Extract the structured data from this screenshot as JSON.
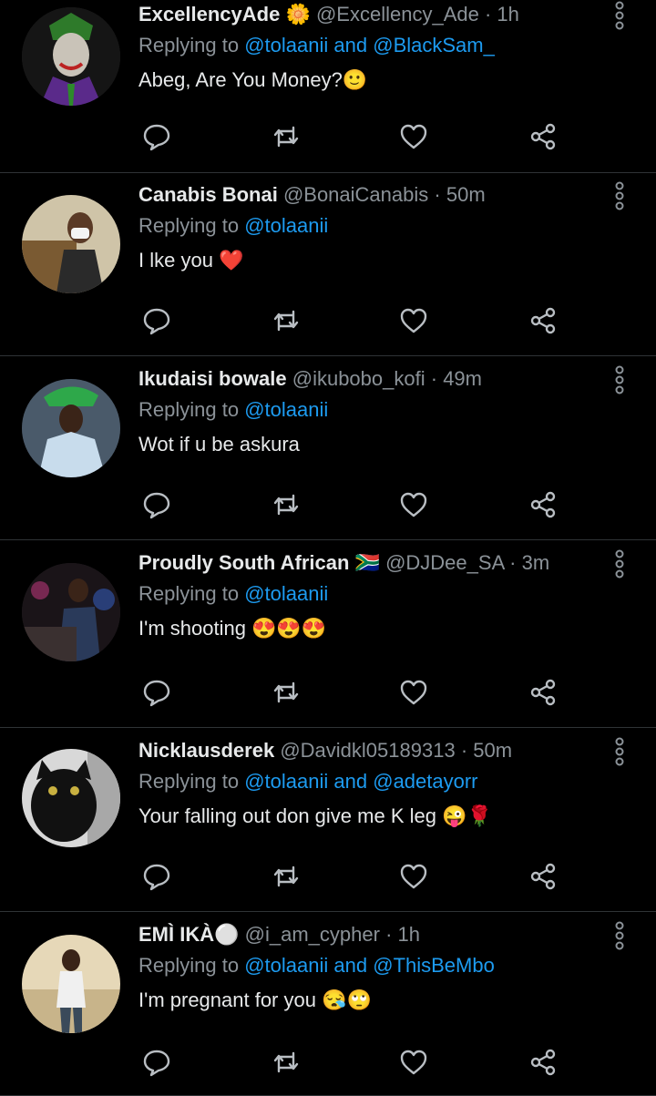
{
  "tweets": [
    {
      "name": "ExcellencyAde",
      "badge": "🌼",
      "handle": "@Excellency_Ade",
      "time": "1h",
      "replying_prefix": "Replying to",
      "mention1": "@tolaanii",
      "joiner": "and",
      "mention2": "@BlackSam_",
      "text": "Abeg, Are You Money?🙂"
    },
    {
      "name": "Canabis Bonai",
      "badge": "",
      "handle": "@BonaiCanabis",
      "time": "50m",
      "replying_prefix": "Replying to",
      "mention1": "@tolaanii",
      "joiner": "",
      "mention2": "",
      "text": "I lke you ❤️"
    },
    {
      "name": "Ikudaisi bowale",
      "badge": "",
      "handle": "@ikubobo_kofi",
      "time": "49m",
      "replying_prefix": "Replying to",
      "mention1": "@tolaanii",
      "joiner": "",
      "mention2": "",
      "text": "Wot if u be askura"
    },
    {
      "name": "Proudly South African",
      "badge": "🇿🇦",
      "handle": "@DJDee_SA",
      "time": "3m",
      "replying_prefix": "Replying to",
      "mention1": "@tolaanii",
      "joiner": "",
      "mention2": "",
      "text": "I'm shooting 😍😍😍"
    },
    {
      "name": "Nicklausderek",
      "badge": "",
      "handle": "@Davidkl05189313",
      "time": "50m",
      "replying_prefix": "Replying to",
      "mention1": "@tolaanii",
      "joiner": "and",
      "mention2": "@adetayorr",
      "text": "Your falling out don give me K leg 😜🌹"
    },
    {
      "name": "EMÌ IKÀ⚪",
      "badge": "",
      "handle": "@i_am_cypher",
      "time": "1h",
      "replying_prefix": "Replying to",
      "mention1": "@tolaanii",
      "joiner": "and",
      "mention2": "@ThisBeMbo",
      "text": "I'm pregnant for you 😪🙄"
    }
  ],
  "separator": "·",
  "icons": {
    "reply": "reply-icon",
    "retweet": "retweet-icon",
    "like": "like-icon",
    "share": "share-icon",
    "more": "more-vertical-icon"
  },
  "colors": {
    "background": "#000000",
    "text": "#e7e9ea",
    "muted": "#8b9298",
    "link": "#1d9bf0",
    "divider": "#2f3336"
  }
}
